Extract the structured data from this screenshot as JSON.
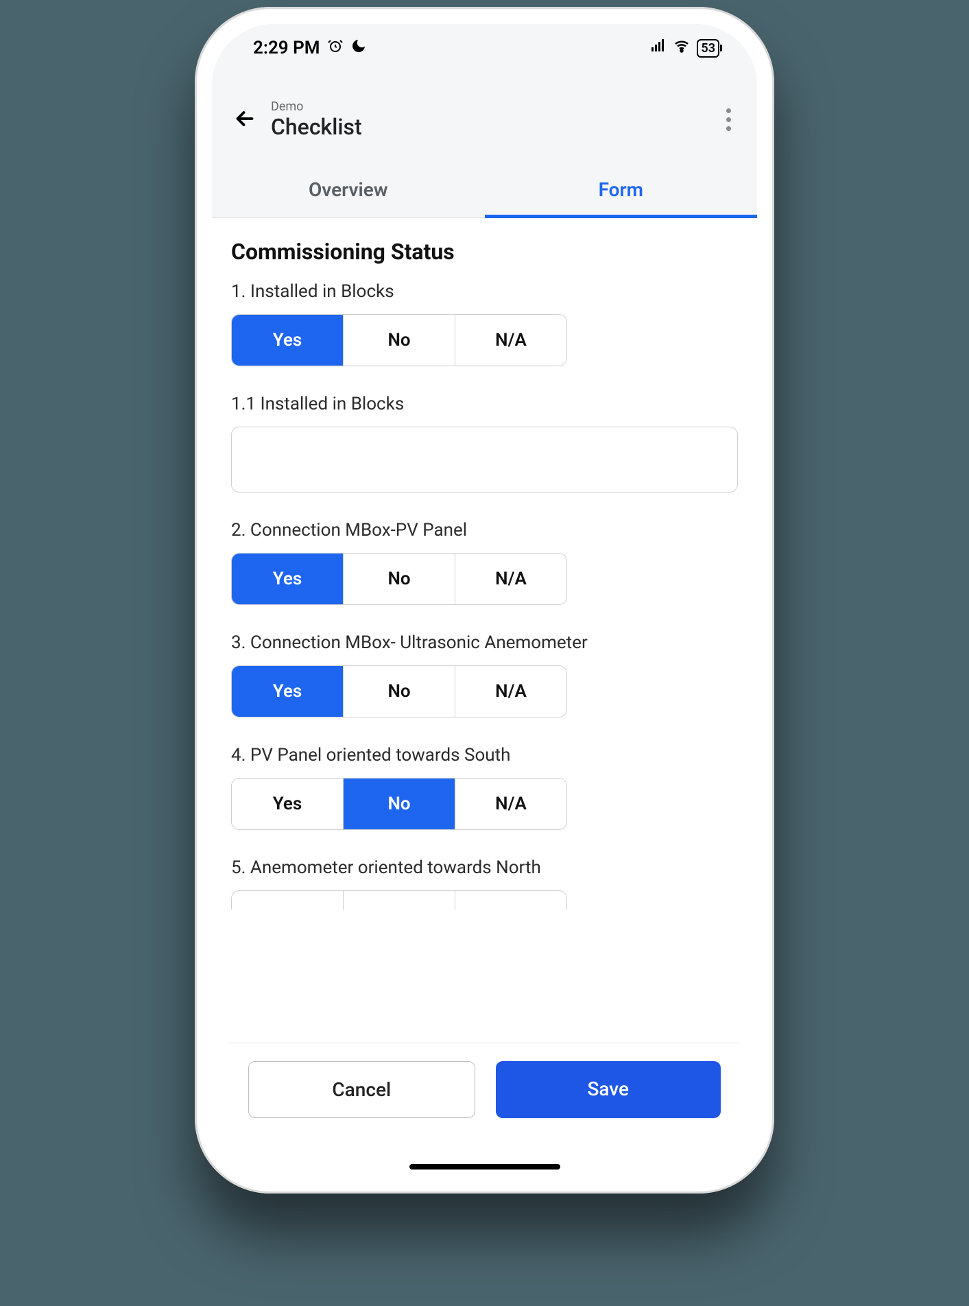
{
  "statusbar": {
    "time": "2:29 PM",
    "battery": "53"
  },
  "header": {
    "subtitle": "Demo",
    "title": "Checklist"
  },
  "tabs": {
    "overview": "Overview",
    "form": "Form",
    "active": "form"
  },
  "section": {
    "title": "Commissioning Status"
  },
  "options": {
    "yes": "Yes",
    "no": "No",
    "na": "N/A"
  },
  "questions": [
    {
      "label": "1. Installed in Blocks",
      "selected": "yes"
    },
    {
      "label": "1.1 Installed in Blocks",
      "type": "text",
      "value": ""
    },
    {
      "label": "2. Connection MBox-PV Panel",
      "selected": "yes"
    },
    {
      "label": "3. Connection MBox- Ultrasonic Anemometer",
      "selected": "yes"
    },
    {
      "label": "4. PV Panel oriented towards South",
      "selected": "no"
    },
    {
      "label": "5. Anemometer oriented towards North",
      "selected": ""
    }
  ],
  "footer": {
    "cancel": "Cancel",
    "save": "Save"
  }
}
